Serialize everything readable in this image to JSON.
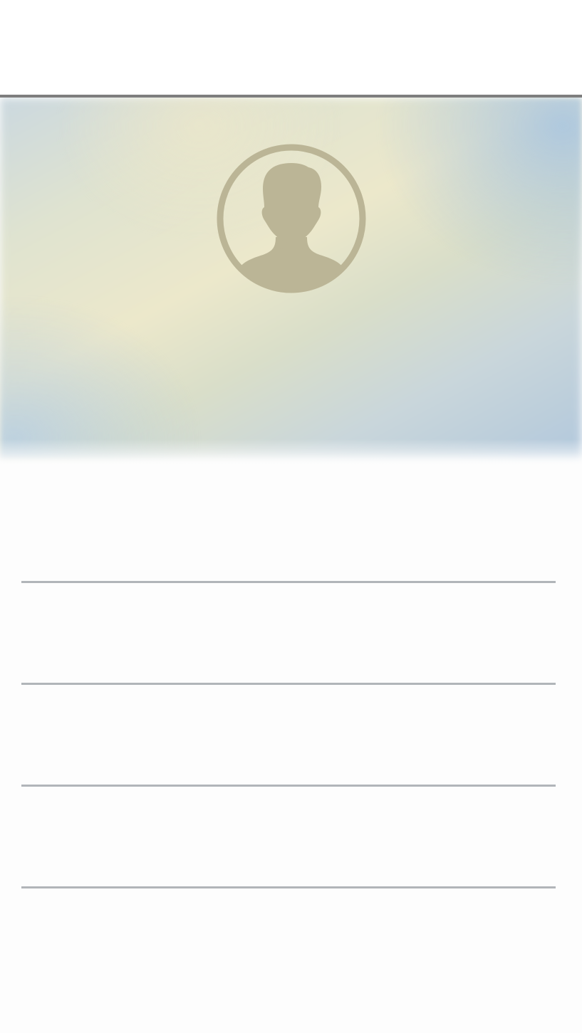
{
  "colors": {
    "background": "#fdfdfd",
    "topbar_background": "#ffffff",
    "topbar_divider": "#7e7e7e",
    "avatar_tint": "#bbb596",
    "row_divider": "#b1b5b9",
    "header_gradient": [
      "#cbd8df",
      "#ece8cb",
      "#b2c8dc"
    ]
  },
  "profile": {
    "avatar_icon": "person-silhouette-icon"
  },
  "list": {
    "rows": [
      {
        "label": ""
      },
      {
        "label": ""
      },
      {
        "label": ""
      },
      {
        "label": ""
      }
    ]
  }
}
